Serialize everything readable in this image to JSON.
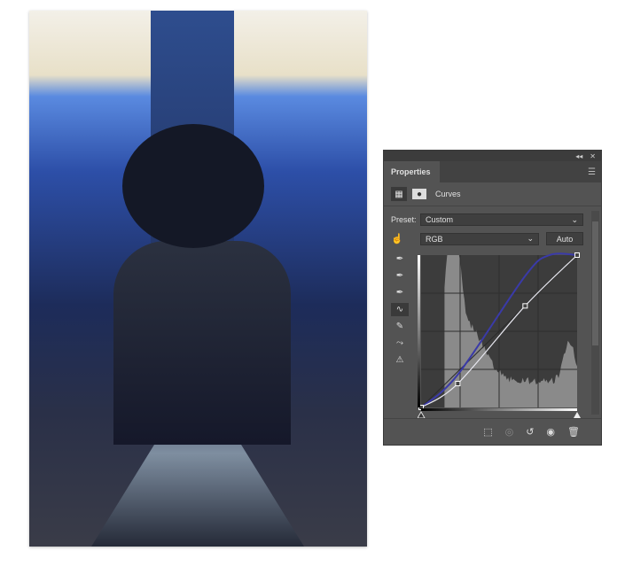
{
  "canvas": {
    "image": "double-exposure-portrait-city-street"
  },
  "panel": {
    "collapse_icon": "double-chevron-left-icon",
    "close_icon": "close-icon",
    "tab_label": "Properties",
    "menu_icon": "hamburger-menu-icon",
    "adjustment_label": "Curves",
    "preset_label": "Preset:",
    "preset_value": "Custom",
    "channel_value": "RGB",
    "auto_label": "Auto",
    "tools": [
      "eyedropper-black-icon",
      "eyedropper-gray-icon",
      "eyedropper-white-icon",
      "curve-points-icon",
      "pencil-icon",
      "smooth-icon",
      "clipping-warning-icon"
    ],
    "curves": {
      "rgb_points": [
        [
          0,
          0
        ],
        [
          60,
          40
        ],
        [
          170,
          170
        ],
        [
          255,
          255
        ]
      ],
      "blue_points": [
        [
          0,
          0
        ],
        [
          60,
          55
        ],
        [
          170,
          220
        ],
        [
          210,
          255
        ],
        [
          255,
          255
        ]
      ],
      "colors": {
        "rgb": "#e8e8f0",
        "blue": "#3a3aa8"
      }
    },
    "footer_icons": [
      "clip-to-layer-icon",
      "view-previous-icon",
      "reset-icon",
      "visibility-eye-icon",
      "trash-icon"
    ]
  }
}
